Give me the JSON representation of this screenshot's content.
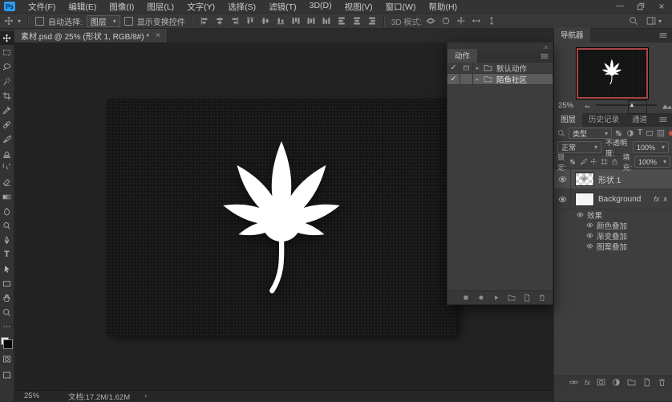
{
  "app": {
    "logo_text": "Ps"
  },
  "menubar": {
    "items": [
      "文件(F)",
      "编辑(E)",
      "图像(I)",
      "图层(L)",
      "文字(Y)",
      "选择(S)",
      "滤镜(T)",
      "3D(D)",
      "视图(V)",
      "窗口(W)",
      "帮助(H)"
    ],
    "window_controls": [
      "minimize",
      "restore",
      "close"
    ]
  },
  "options": {
    "tool_icon": "move",
    "auto_select_label": "自动选择:",
    "auto_select_value": "图层",
    "show_transform_label": "显示变换控件",
    "align_icons": [
      "align-left",
      "align-center-h",
      "align-right",
      "align-top",
      "align-middle",
      "align-bottom",
      "distribute-top",
      "distribute-middle",
      "distribute-bottom",
      "distribute-left",
      "distribute-center-h",
      "distribute-right"
    ],
    "mode_3d_label": "3D 模式:",
    "mode3d_icons": [
      "orbit-3d",
      "roll-3d",
      "pan-3d",
      "slide-3d",
      "zoom-3d"
    ],
    "right_icons": [
      "search",
      "workspace-switcher"
    ]
  },
  "toolbar": {
    "tools": [
      {
        "id": "move",
        "active": true
      },
      {
        "id": "rect-marquee"
      },
      {
        "id": "lasso"
      },
      {
        "id": "quick-selection"
      },
      {
        "id": "crop"
      },
      {
        "id": "eyedropper"
      },
      {
        "id": "spot-healing"
      },
      {
        "id": "brush"
      },
      {
        "id": "clone-stamp"
      },
      {
        "id": "history-brush"
      },
      {
        "id": "eraser"
      },
      {
        "id": "gradient"
      },
      {
        "id": "blur"
      },
      {
        "id": "dodge"
      },
      {
        "id": "pen"
      },
      {
        "id": "type"
      },
      {
        "id": "path-selection"
      },
      {
        "id": "rectangle"
      },
      {
        "id": "hand"
      },
      {
        "id": "zoom"
      },
      {
        "id": "edit-toolbar"
      }
    ],
    "bottom_icons": [
      "quick-mask",
      "screen-mode"
    ]
  },
  "document": {
    "tab_title": "素材.psd @ 25% (形状 1, RGB/8#) *",
    "tab_close": "×"
  },
  "actions_panel": {
    "title": "动作",
    "sets": [
      {
        "name": "默认动作",
        "checked": true,
        "dialog": true,
        "selected": false
      },
      {
        "name": "陌鱼社区",
        "checked": true,
        "dialog": false,
        "selected": true
      }
    ],
    "footer_icons": [
      "stop",
      "record",
      "play",
      "new-set-folder",
      "new-action",
      "delete-action"
    ]
  },
  "navigator": {
    "title": "导航器",
    "zoom_value": "25%",
    "frame_color": "#a84444"
  },
  "layers_panel": {
    "tabs": [
      {
        "label": "图层",
        "active": true
      },
      {
        "label": "历史记录",
        "active": false
      },
      {
        "label": "通道",
        "active": false
      }
    ],
    "filter_label": "类型",
    "filter_icons": [
      "pixel-layer-filter",
      "adjustment-layer-filter",
      "type-layer-filter",
      "shape-layer-filter",
      "smart-object-filter"
    ],
    "blend_mode": "正常",
    "opacity_label": "不透明度:",
    "opacity_value": "100%",
    "lock_label": "锁定:",
    "lock_icons": [
      "lock-transparent",
      "lock-image",
      "lock-position",
      "lock-artboard",
      "lock-all"
    ],
    "fill_label": "填充:",
    "fill_value": "100%",
    "layers": [
      {
        "name": "形状 1",
        "thumb": "checker",
        "selected": true,
        "visible": true
      },
      {
        "name": "Background",
        "thumb": "white",
        "selected": false,
        "visible": true,
        "has_fx": true
      }
    ],
    "effects_group_label": "效果",
    "effects": [
      "颜色叠加",
      "渐变叠加",
      "图案叠加"
    ],
    "footer_icons": [
      "link-layers",
      "layer-style-fx",
      "layer-mask",
      "adjustment-layer",
      "new-group",
      "new-layer",
      "delete-layer"
    ]
  },
  "statusbar": {
    "zoom": "25%",
    "doc_info": "文档:17.2M/1.62M"
  }
}
